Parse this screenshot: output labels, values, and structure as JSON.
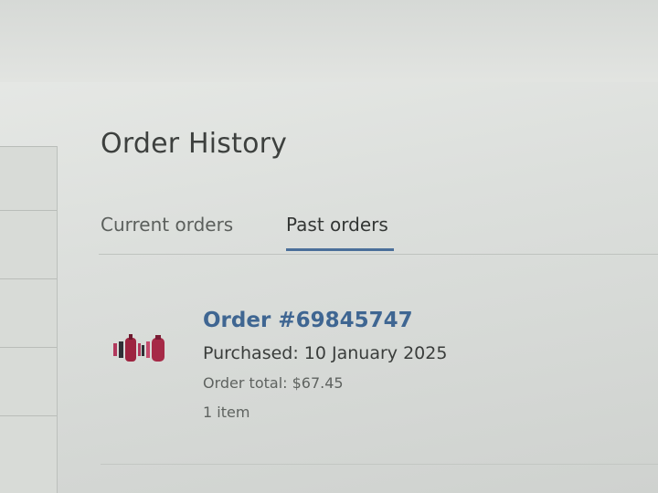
{
  "page": {
    "title": "Order History"
  },
  "tabs": [
    {
      "label": "Current orders",
      "active": false
    },
    {
      "label": "Past orders",
      "active": true
    }
  ],
  "order": {
    "number": "Order #69845747",
    "purchased": "Purchased: 10 January 2025",
    "total": "Order total: $67.45",
    "items": "1 item",
    "thumbnail_icon": "product-thumbnail"
  },
  "colors": {
    "accent": "#4b6f9a",
    "link": "#3f6692",
    "text": "#3a3d3b",
    "muted": "#5f6360"
  }
}
